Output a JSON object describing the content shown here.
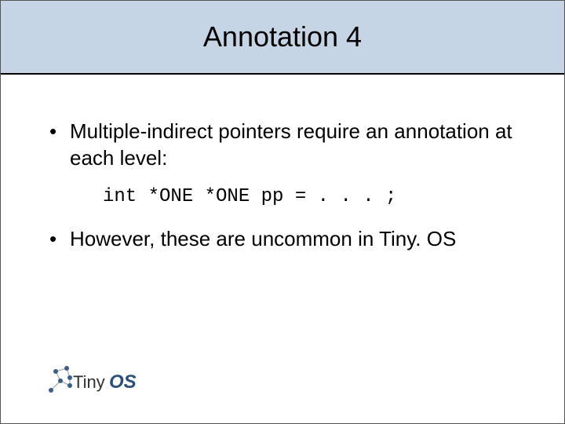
{
  "title": "Annotation 4",
  "bullets": [
    "Multiple-indirect pointers require an annotation at each level:",
    "However, these are uncommon in Tiny. OS"
  ],
  "code": "int *ONE *ONE pp = . . . ;",
  "logo": {
    "name": "TinyOS",
    "text_tiny": "Tiny",
    "text_os": "OS"
  }
}
